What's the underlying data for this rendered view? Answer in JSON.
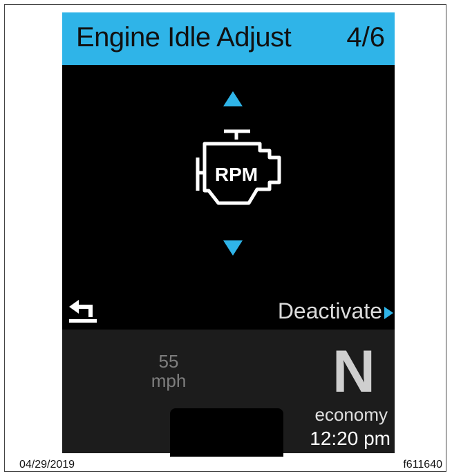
{
  "header": {
    "title": "Engine Idle Adjust",
    "page_indicator": "4/6"
  },
  "main": {
    "icon": "engine-rpm-icon",
    "icon_label": "RPM"
  },
  "footer_actions": {
    "back_icon": "back-icon",
    "deactivate_label": "Deactivate"
  },
  "status_bar": {
    "speed_value": "55",
    "speed_unit": "mph",
    "gear": "N",
    "mode": "economy",
    "time": "12:20 pm"
  },
  "caption": {
    "date": "04/29/2019",
    "figure_id": "f611640"
  },
  "colors": {
    "accent": "#2fb4e8",
    "screen_bg": "#000000",
    "status_bg": "#1c1c1c"
  }
}
